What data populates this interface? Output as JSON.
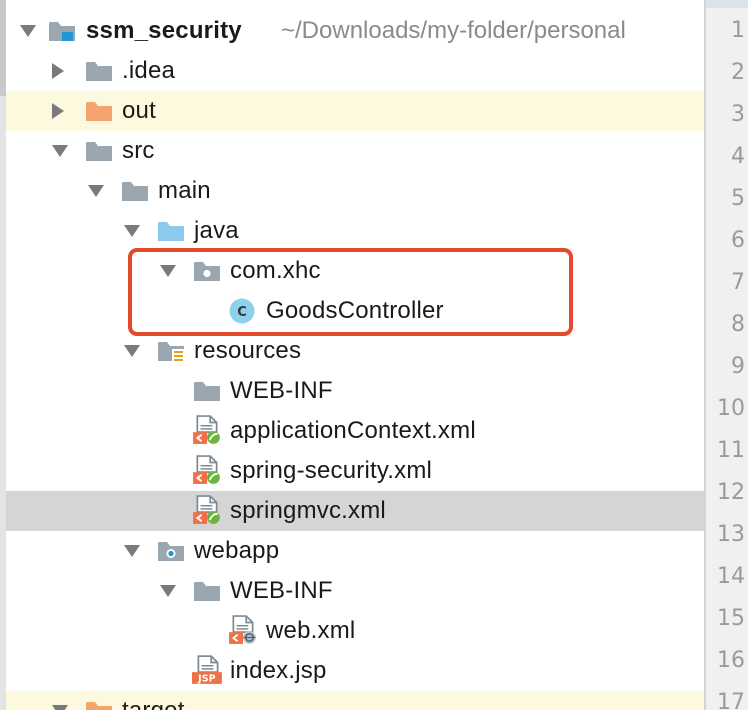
{
  "project_tree": {
    "root": {
      "name": "ssm_security",
      "path": "~/Downloads/my-folder/personal"
    },
    "items": [
      {
        "label": ".idea"
      },
      {
        "label": "out"
      },
      {
        "label": "src"
      },
      {
        "label": "main"
      },
      {
        "label": "java"
      },
      {
        "label": "com.xhc"
      },
      {
        "label": "GoodsController",
        "badge": "C"
      },
      {
        "label": "resources"
      },
      {
        "label": "WEB-INF"
      },
      {
        "label": "applicationContext.xml"
      },
      {
        "label": "spring-security.xml"
      },
      {
        "label": "springmvc.xml"
      },
      {
        "label": "webapp"
      },
      {
        "label": "WEB-INF"
      },
      {
        "label": "web.xml"
      },
      {
        "label": "index.jsp",
        "badge": "JSP"
      },
      {
        "label": "target"
      }
    ]
  },
  "gutter": {
    "line_numbers": [
      "1",
      "2",
      "3",
      "4",
      "5",
      "6",
      "7",
      "8",
      "9",
      "10",
      "11",
      "12",
      "13",
      "14",
      "15",
      "16",
      "17"
    ]
  },
  "colors": {
    "selection_outline": "#e5492b",
    "folder_gray": "#9aa7b0",
    "folder_orange": "#f4a46f",
    "folder_blue": "#8cc9ea",
    "excluded_row_bg": "#fcf9df",
    "selected_row_bg": "#d5d5d5"
  },
  "icons": {
    "expand": "chevron-down-icon",
    "collapse": "chevron-right-icon",
    "module": "module-folder-icon",
    "folder": "folder-icon",
    "source_root": "source-root-folder-icon",
    "package": "package-icon",
    "class": "java-class-icon",
    "resources": "resources-folder-icon",
    "spring_xml": "spring-xml-icon",
    "web_xml": "web-xml-icon",
    "jsp": "jsp-file-icon"
  }
}
